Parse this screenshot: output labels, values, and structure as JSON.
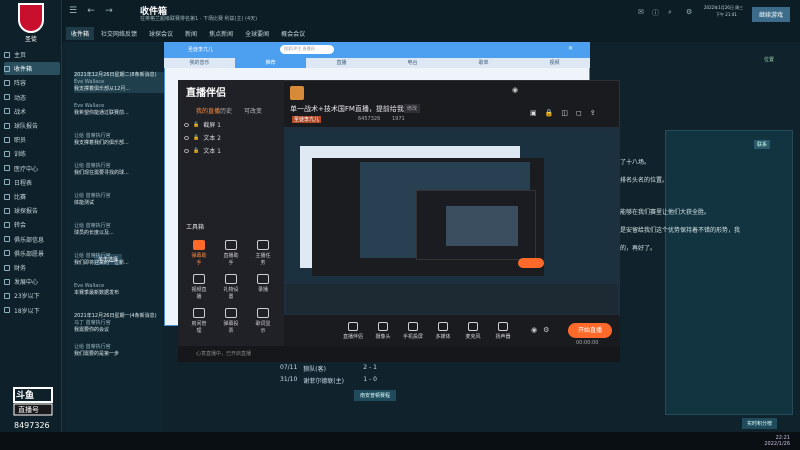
{
  "fm": {
    "club_short": "圣徒",
    "page_title": "收件箱",
    "page_subtitle": "在英格兰超级联赛排名第1 · 下场比赛 利兹(主) (4天)",
    "tabs": [
      "收件箱",
      "社交网络反馈",
      "球探会议",
      "新闻",
      "焦点新闻",
      "全球要闻",
      "概会会议"
    ],
    "active_tab": 0,
    "date_line1": "2022年1月26日 周三",
    "date_line2": "下午 21:41",
    "continue": "继续游戏",
    "sidebar": [
      {
        "label": "主页"
      },
      {
        "label": "收件箱"
      },
      {
        "label": "阵容"
      },
      {
        "label": "动态"
      },
      {
        "label": "战术"
      },
      {
        "label": "球队报告"
      },
      {
        "label": "职员"
      },
      {
        "label": "训练"
      },
      {
        "label": "医疗中心"
      },
      {
        "label": "日程表"
      },
      {
        "label": "比赛"
      },
      {
        "label": "球探报告"
      },
      {
        "label": "转会"
      },
      {
        "label": "俱乐部信息"
      },
      {
        "label": "俱乐部愿景"
      },
      {
        "label": "财务"
      },
      {
        "label": "发展中心"
      },
      {
        "label": "23岁以下"
      },
      {
        "label": "18岁以下"
      }
    ],
    "inbox": [
      {
        "date": "2021年12月26日星期二(8条新消息)",
        "from": "Eve Wallace",
        "title": "我支撑着俱乐部从12月..."
      },
      {
        "date": "",
        "from": "Eve Wallace",
        "title": "我希望你能通过联赛前..."
      },
      {
        "date": "",
        "from": "让给 首席执行官",
        "title": "我支撑着我们的俱乐部..."
      },
      {
        "date": "",
        "from": "让给 首席执行官",
        "title": "我们现在需要寻找的球..."
      },
      {
        "date": "",
        "from": "让给 首席执行官",
        "title": "体能测试"
      },
      {
        "date": "",
        "from": "让给 首席执行官",
        "title": "球员的长度以及..."
      },
      {
        "date": "",
        "from": "让给 首席执行官",
        "title": "我们即将迎来的一位新..."
      },
      {
        "date": "",
        "from": "Eve Wallace",
        "title": "本赛季最新数据发布"
      },
      {
        "date": "2021年12月26日星期一(4条新消息)",
        "from": "马丁 首席执行官",
        "title": "我需要你的会议"
      },
      {
        "date": "",
        "from": "让给 首席执行官",
        "title": "我们需要的是第一步"
      }
    ],
    "select_button": "单击选择",
    "right_panel": {
      "badge": "联系",
      "lines": [
        "了十八场。",
        "排名头名的位置。",
        "能够在我们赛里让他们大获全胜。",
        "是安留给我们这个优势保持着不错的形势，我",
        "的，再好了。"
      ]
    },
    "fixtures": [
      {
        "date": "07/11",
        "team": "狼队(客)",
        "score": "2 - 1"
      },
      {
        "date": "31/10",
        "team": "谢菲尔德联(主)",
        "score": "1 - 0"
      }
    ],
    "fixtures_button": "南安普顿赛程",
    "live_score": "实时积分榜"
  },
  "bluewin": {
    "channel": "圣徒李亢儿",
    "search_placeholder": "搜索UP主 直播间",
    "tabs": [
      "我的音乐",
      "推荐",
      "直播",
      "电台",
      "歌单",
      "视频"
    ],
    "active_tab": 1
  },
  "companion": {
    "app_name": "直播伴侣",
    "tabs": [
      "我的直播",
      "历史",
      "可改变"
    ],
    "active_tab": 0,
    "scenes": [
      "截屏 1",
      "文本 2",
      "文本 1"
    ],
    "tools_heading": "工具箱",
    "tools": [
      {
        "label": "弹幕助手",
        "hot": true
      },
      {
        "label": "直播助手",
        "hot": false
      },
      {
        "label": "主播任务",
        "hot": false
      },
      {
        "label": "视频直播",
        "hot": false
      },
      {
        "label": "礼物设置",
        "hot": false
      },
      {
        "label": "录播",
        "hot": false
      },
      {
        "label": "房间管理",
        "hot": false
      },
      {
        "label": "弹幕投票",
        "hot": false
      },
      {
        "label": "歌词显示",
        "hot": false
      }
    ],
    "stream_title": "单一战术+技术国FM直播，提前给我家安",
    "edit": "修改",
    "streamer": "圣徒李亢儿",
    "fans": "6457326",
    "hot": "1971",
    "bottom_tools": [
      "直播伴侣",
      "摄像头",
      "手机投屏",
      "多媒体",
      "麦克风",
      "扬声器"
    ],
    "live_button": "开始直播",
    "timer": "00:00:00",
    "footer": "心意直播中，已开启直播"
  },
  "douyu": {
    "brand": "斗鱼",
    "sub": "直播号",
    "room": "8497326"
  },
  "taskbar": {
    "time": "22:21",
    "date": "2022/1/26"
  }
}
